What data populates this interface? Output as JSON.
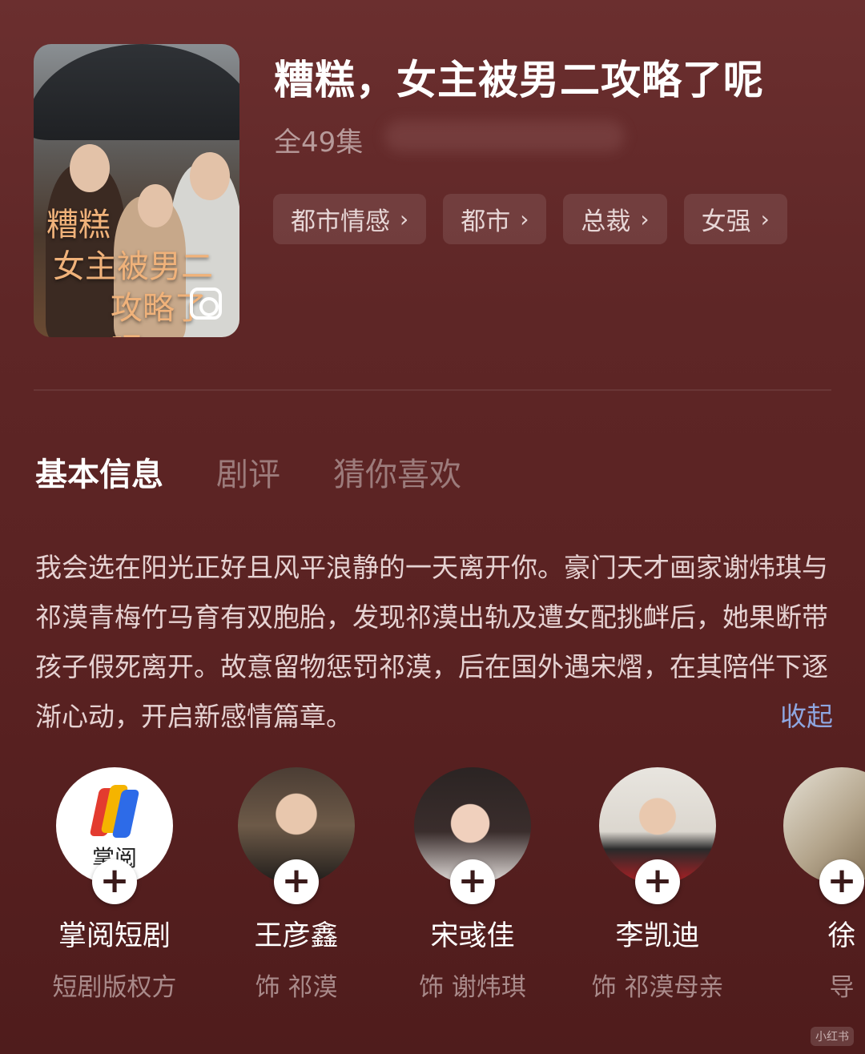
{
  "drama": {
    "poster_title_line1": "糟糕",
    "poster_title_line2": "女主被男二",
    "poster_title_line3": "攻略了呢",
    "title": "糟糕，女主被男二攻略了呢",
    "episodes": "全49集",
    "tags": [
      {
        "label": "都市情感",
        "chevron": "›"
      },
      {
        "label": "都市",
        "chevron": "›"
      },
      {
        "label": "总裁",
        "chevron": "›"
      },
      {
        "label": "女强",
        "chevron": "›"
      }
    ]
  },
  "tabs": [
    {
      "label": "基本信息",
      "active": true
    },
    {
      "label": "剧评",
      "active": false
    },
    {
      "label": "猜你喜欢",
      "active": false
    }
  ],
  "description": {
    "text": "我会选在阳光正好且风平浪静的一天离开你。豪门天才画家谢炜琪与祁漠青梅竹马育有双胞胎，发现祁漠出轨及遭女配挑衅后，她果断带孩子假死离开。故意留物惩罚祁漠，后在国外遇宋熠，在其陪伴下逐渐心动，开启新感情篇章。",
    "collapse_label": "收起"
  },
  "cast": [
    {
      "name": "掌阅短剧",
      "role": "短剧版权方",
      "logo_text": "掌阅",
      "plus": "+"
    },
    {
      "name": "王彦鑫",
      "role": "饰 祁漠",
      "plus": "+"
    },
    {
      "name": "宋彧佳",
      "role": "饰 谢炜琪",
      "plus": "+"
    },
    {
      "name": "李凯迪",
      "role": "饰 祁漠母亲",
      "plus": "+"
    },
    {
      "name": "徐",
      "role": "导",
      "plus": "+"
    }
  ],
  "watermark": "小红书",
  "colors": {
    "background": "#5e2626",
    "accent_link": "#8ea6e0",
    "poster_title": "#f0b27a"
  }
}
